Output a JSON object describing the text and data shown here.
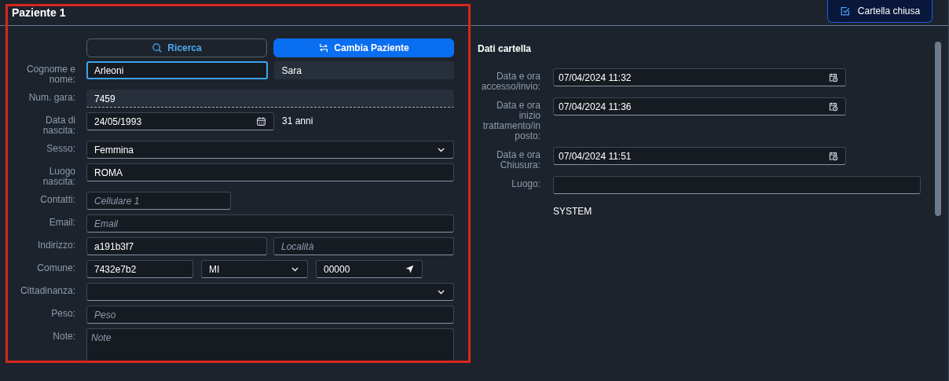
{
  "header": {
    "title": "Paziente 1",
    "button": "Cartella chiusa"
  },
  "patient": {
    "buttons": [
      {
        "label": "Ricerca",
        "kind": "secondary"
      },
      {
        "label": "Cambia Paziente",
        "kind": "primary"
      }
    ],
    "fields": [
      {
        "label": "Cognome e nome:",
        "inputs": [
          {
            "kind": "text",
            "value": "Arleoni",
            "focused": true
          },
          {
            "kind": "display",
            "value": "Sara",
            "focused": false
          }
        ]
      },
      {
        "label": "Num. gara:",
        "inputs": [
          {
            "kind": "readonly",
            "value": "7459",
            "focused": false
          }
        ]
      },
      {
        "label": "Data di nascita:",
        "inputs": [
          {
            "kind": "date",
            "value": "24/05/1993",
            "focused": false
          },
          {
            "kind": "note",
            "value": "31 anni"
          }
        ]
      },
      {
        "label": "Sesso:",
        "inputs": [
          {
            "kind": "select",
            "value": "Femmina",
            "focused": false
          }
        ]
      },
      {
        "label": "Luogo nascita:",
        "inputs": [
          {
            "kind": "text",
            "value": "ROMA",
            "focused": false
          }
        ]
      },
      {
        "label": "Contatti:",
        "inputs": [
          {
            "kind": "phone",
            "placeholder": "Cellulare 1",
            "focused": false
          }
        ]
      },
      {
        "label": "Email:",
        "inputs": [
          {
            "kind": "text",
            "placeholder": "Email",
            "focused": false
          }
        ]
      },
      {
        "label": "Indirizzo:",
        "inputs": [
          {
            "kind": "text",
            "value": "a191b3f7",
            "focused": false
          },
          {
            "kind": "text",
            "placeholder": "Località",
            "focused": false
          }
        ]
      },
      {
        "label": "Comune:",
        "inputs": [
          {
            "kind": "text",
            "value": "7432e7b2",
            "focused": false
          },
          {
            "kind": "select",
            "value": "MI",
            "focused": false
          },
          {
            "kind": "locate",
            "value": "00000",
            "focused": false
          }
        ]
      },
      {
        "label": "Cittadinanza:",
        "inputs": [
          {
            "kind": "select",
            "focused": false
          }
        ]
      },
      {
        "label": "Peso:",
        "inputs": [
          {
            "kind": "text",
            "placeholder": "Peso",
            "focused": false
          }
        ]
      },
      {
        "label": "Note:",
        "inputs": [
          {
            "kind": "textarea",
            "placeholder": "Note",
            "focused": false
          }
        ]
      }
    ]
  },
  "record": {
    "title": "Dati cartella",
    "fields": [
      {
        "label": "Data e ora accesso/invio:",
        "kind": "datetime",
        "value": "07/04/2024 11:32"
      },
      {
        "label": "Data e ora inizio trattamento/in posto:",
        "kind": "datetime",
        "value": "07/04/2024 11:36"
      },
      {
        "label": "Data e ora Chiusura:",
        "kind": "datetime",
        "value": "07/04/2024 11:51"
      },
      {
        "label": "Luogo:",
        "kind": "text"
      }
    ],
    "user": "SYSTEM"
  }
}
